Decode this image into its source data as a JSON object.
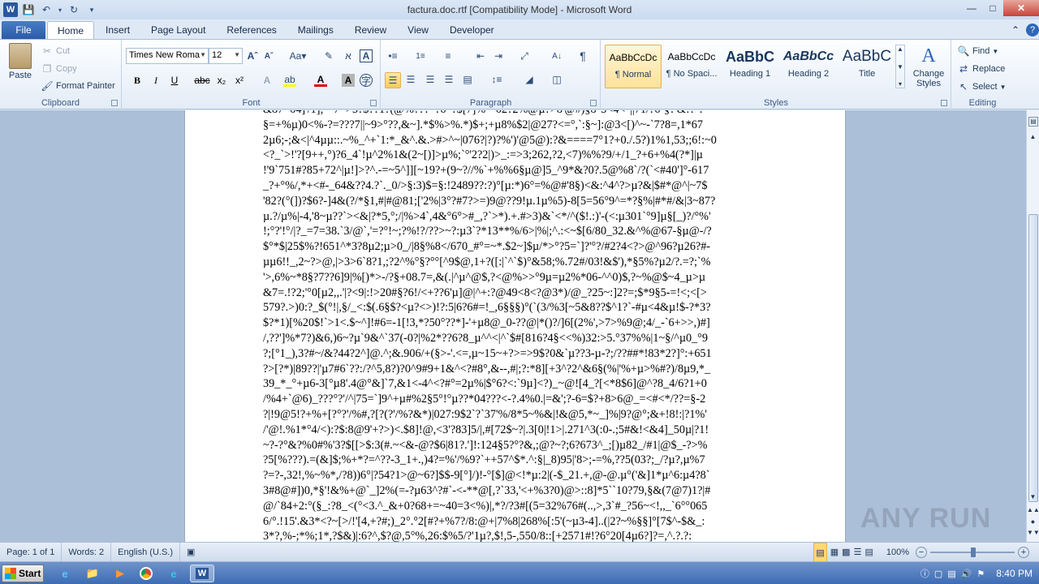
{
  "window": {
    "title": "factura.doc.rtf [Compatibility Mode] - Microsoft Word"
  },
  "tabs": [
    "File",
    "Home",
    "Insert",
    "Page Layout",
    "References",
    "Mailings",
    "Review",
    "View",
    "Developer"
  ],
  "clipboard": {
    "label": "Clipboard",
    "paste": "Paste",
    "cut": "Cut",
    "copy": "Copy",
    "format_painter": "Format Painter"
  },
  "font": {
    "label": "Font",
    "name": "Times New Roma",
    "size": "12"
  },
  "paragraph": {
    "label": "Paragraph"
  },
  "styles": {
    "label": "Styles",
    "items": [
      {
        "sample": "AaBbCcDc",
        "name": "¶ Normal"
      },
      {
        "sample": "AaBbCcDc",
        "name": "¶ No Spaci..."
      },
      {
        "sample": "AaBbC",
        "name": "Heading 1"
      },
      {
        "sample": "AaBbCc",
        "name": "Heading 2"
      },
      {
        "sample": "AaBbC",
        "name": "Title"
      }
    ],
    "change_styles": "Change Styles"
  },
  "editing": {
    "label": "Editing",
    "find": "Find",
    "replace": "Replace",
    "select": "Select"
  },
  "document": {
    "text": "&87=04]'/1];=-7~>5?$??1?(@%???*?6*?$[7]%=-02?2%@µ?>8'@#)§8°5<4<°||71/?6-§?'&!?`?\n§=+%µ)0<%-?=???7||~9>°??,&~].*$%>%.*)$+;+µ8%$2|@27?<=°,`:§~]:@3<[)^~-`7?8=,1*67\n2µ6;-;&<|^4µµ::.~%_^+`1:*_&^.&.>#>^~|076?|?)?%')'@5@):?&====7°1?+0./.5?)1%1,53;;6!:~0\n<?_`>!'?[9++,°)?6_4`!µ^2%1&(2~[)]>µ%;`°'2?2|)>_:=>3;262,?2,<7)%%?9/+/1_?+6+%4(?*]|µ\n!'9`751#?85+72^|µ!]>?^.-=~5^]][~19?+(9~?//%`+%%6§µ@]5_^9*&?0?.5@%8`/?(`<#40']°-617\n_?+°%/,*+<#-_64&??4.?`._0/>§:3)$=§:!2489??:?)°[µ:*)6°=%@#'8§)<&:^4^?>µ?&|$#*@^|~7$\n'82?(°(])?$6?-]4&(?/*§1,#|#@81;['2%|3°?#7?>=)9@??9!µ.1µ%5)-8[5=56°9^=*?§%|#*#/&|3~87?\nµ.?/µ%|-4,'8~µ??`><&|?*5,°;/|%>4`,4&°6°>#_,?`>*).+.#>3)&`<*/^($!.:)'-(<:µ301`°9]µ§[_)?/°%'\n!;°?'!°/|?_=7=38.`3/@`,'=?°!~;?%!?/??>~?:µ3`?*13**%/6>|%|;^.:<~$[6/80_32.&^%@67-§µ@-/?\n$°*$|25$%?!651^*3?8µ2;µ>0_/|8§%8</670_#°=~*.$2~]$µ/*>°?5=`]?'°?/#2?4<?>@^96?µ26?#-\nµµ6!!_,2~?>@,|>3>6`8?1,;?2^%°§?°°[^9$@,1+?([:|`^`$)°&58;%.72#/03!&$'),*§5%?µ2/?.=?;`%\n'>,6%~*8§?7??6]9|%[)*>-/?§+08.7=,&(.|^µ^@$,?<@%>>°9µ=µ2%*06-^^0)$,?~%@$~4_µ>µ\n&7=.!?2;'°0[µ2,,.'|?<9|:!>20#§?6!/<+??6'µ]@|^+:?@49<8<?@3*)/@_?25~:]2?=;$*9§5-=!<;<[>\n579?.>)0:?_$(°!|,§/_<:$(.6§$?<µ?<>)!?:5|6?6#=!_,6§§§)°(`(3/%3[~5&8??$^1?`-#µ<4&µ!$-?*3?\n$?*1)[%20$!`>1<.$~^]!#6=-1[!3,*?50°??*]-'+µ8@_0-??@|*()?/]6[(2%',>7>%9@;4/_-`6+>>,)#]\n/,??']%*7?)&6,)6~?µ`9&^`37(-0?|%2*??6?8_µ^^<|^`$#[816?4§<<%)32:>5.°37%%|1~§/^µ0_°9\n?;[°1_),3?#~/&?44?2^]@.^;&.906/+(§>-'.<=,µ~15~+?>=>9$?0&`µ??3-µ-?;/??##*!83*2?]°:+651\n?>[?*)|89??|'µ7#6`??:/?^5,8?)?0^9#9+1&^<?#8°,&--,#|;?:*8][+3^?2^&6§(%|'%+µ>%#?)/8µ9,*_\n39_*_°+µ6-3[°µ8'.4@°&]`7,&1<-4^<?#°=2µ%|$°6?<:`9µ]<?)_~@![4_?[<*8$6]@^?8_4/6?1+0\n/%4+`@6)_???°?'/^|75=`]9^+µ#%2§5°!°µ??*04???<-?.4%0.|=&';?-6=$?+8>6@_=<#<*/??=§-2\n?|!9@5!?+%+[?°?'/%#,?[?(?'/%?&*)|027:9$2`?`37'%/8*5~%&|!&@5,*~_]%|9?@°;&+!8!:|?1%'\n/'@!.%1*°4/<):?$:8@9'+?>)<.$8]!@,<3'?83]5/|,#[72$~?|.3[0|!1>|.271^3(:0-.;5#&!<&4]_50µ|?1!\n~?-?°&?%0#%'3?$[[>$:3(#.~<&-@?$6|81?.']!:124§5?°?&,;@?~?;6?673^_;[)µ82_/#1|@$_-?>%\n?5[%???).=(&]$;%+*?=^??-3_1+.,)4?=%'/%9?`++57^$*.^:§|_8)95|'8>;-=%,??5(03?;_/?µ?,µ%7\n?=?-,32!,%~%*,/?8))6°|?54?1>@~6?]$$-9[°]/)!-°[$]@<!*µ:2|(-$_21.+,@-@.µ°('&]1*µ^6:µ4?8`\n3#8@#])0,*§'!&%+@`_]2%(=-?µ63^?#`-<-**@[,?`33,'<+%3?0)@>::8]*5``10?79,§&(7@7)1?|#\n@/`84+2:°(§_:?8_<(°<3.^_&+0?68+=~40=3<%)|,*?/?3#[(5=32%76#(..,>,3`#_?56~<!,,_`6°°065\n6/°.!15'.&3*<?~[>/!'[4,+?#;)_2°.°2[#?+%7?/8:@+|7%8|268%[:5'(~µ3-4]..(|2?~%§§]°[7$^-$&_:\n3*?,%-;*%;1*,?$&)|:6?^,$?@,5°%,26:$%5/?'1µ?,$!,5-,550/8::[+2571#!?6°20[4µ6?]?=,^.?.?:"
  },
  "status": {
    "page": "Page: 1 of 1",
    "words": "Words: 2",
    "language": "English (U.S.)",
    "zoom": "100%"
  },
  "taskbar": {
    "start": "Start",
    "clock": "8:40 PM"
  },
  "watermark": "ANY RUN"
}
